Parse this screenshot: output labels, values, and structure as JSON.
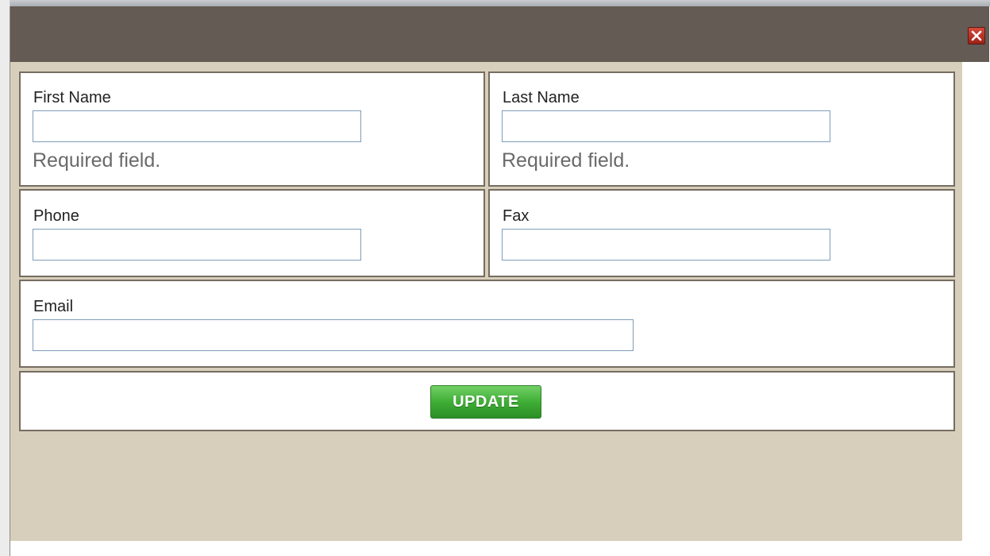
{
  "dialog": {
    "close_icon": "close-x-icon"
  },
  "form": {
    "first_name": {
      "label": "First Name",
      "value": "",
      "hint": "Required field."
    },
    "last_name": {
      "label": "Last Name",
      "value": "",
      "hint": "Required field."
    },
    "phone": {
      "label": "Phone",
      "value": ""
    },
    "fax": {
      "label": "Fax",
      "value": ""
    },
    "email": {
      "label": "Email",
      "value": ""
    },
    "submit_label": "UPDATE"
  },
  "colors": {
    "header_bg": "#635b54",
    "body_bg": "#d7cfbb",
    "panel_border": "#766c60",
    "input_border": "#7f9db9",
    "button_green": "#3fae36",
    "close_red": "#b8302a"
  }
}
